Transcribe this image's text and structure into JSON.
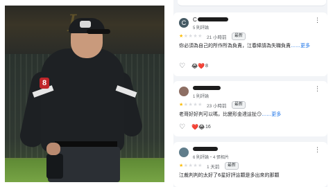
{
  "reviews": [
    {
      "avatar_letter": "C",
      "avatar_color": "#455a64",
      "name_initial": "C",
      "meta": "5 則評論",
      "rating": 1,
      "time": "21 小時前",
      "badge": "最新",
      "text": "你必須為自己的所作所為負責，江春緯請為失職負責",
      "more_label": "……更多",
      "reactions": "😂❤️",
      "reaction_count": "8"
    },
    {
      "avatar_letter": "",
      "avatar_color": "#8d6e63",
      "name_initial": "",
      "meta": "1 則評論",
      "rating": 1,
      "time": "23 小時前",
      "badge": "最新",
      "text": "老哥好好判可以嗎，比變形金達這扯😏",
      "more_label": "……更多",
      "reactions": "❤️😂",
      "reaction_count": "16"
    },
    {
      "avatar_letter": "",
      "avatar_color": "#607d8b",
      "name_initial": "",
      "meta": "6 則評論・4 張相片",
      "rating": 1,
      "time": "1 天前",
      "badge": "最新",
      "text": "江裁判判的太好了6星好評這顆是多出來的那顆",
      "more_label": "",
      "reactions": "",
      "reaction_count": ""
    }
  ],
  "photo": {
    "badge_number": "8"
  },
  "icons": {
    "menu": "more-vert-icon",
    "like": "heart-outline-icon",
    "star": "star-icon"
  },
  "colors": {
    "star_active": "#fbbc04",
    "link": "#1a73e8"
  }
}
